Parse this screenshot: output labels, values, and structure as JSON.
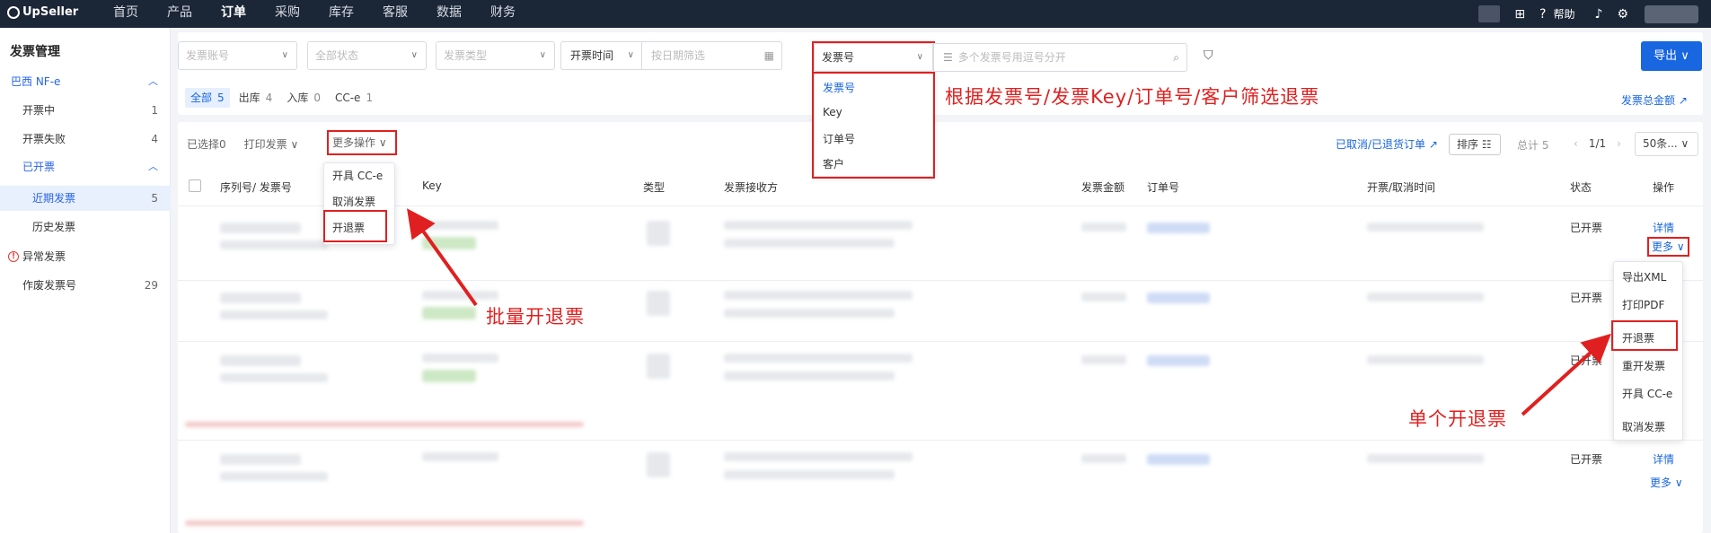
{
  "topbar": {
    "logo": "UpSeller",
    "nav": [
      "首页",
      "产品",
      "订单",
      "采购",
      "库存",
      "客服",
      "数据",
      "财务"
    ],
    "active_nav": "订单",
    "help": "帮助"
  },
  "sidebar": {
    "title": "发票管理",
    "group": "巴西 NF-e",
    "items": [
      {
        "label": "开票中",
        "count": "1"
      },
      {
        "label": "开票失败",
        "count": "4"
      },
      {
        "label": "已开票",
        "count": ""
      },
      {
        "label": "近期发票",
        "count": "5"
      },
      {
        "label": "历史发票",
        "count": ""
      },
      {
        "label": "异常发票",
        "count": ""
      },
      {
        "label": "作废发票号",
        "count": "29"
      }
    ]
  },
  "filters": {
    "account_placeholder": "发票账号",
    "status_placeholder": "全部状态",
    "type_placeholder": "发票类型",
    "date_type": "开票时间",
    "date_placeholder": "按日期筛选",
    "search_type": "发票号",
    "search_placeholder": "多个发票号用逗号分开",
    "export_label": "导出"
  },
  "search_type_options": [
    "发票号",
    "Key",
    "订单号",
    "客户"
  ],
  "tabs": [
    {
      "label": "全部",
      "count": "5"
    },
    {
      "label": "出库",
      "count": "4"
    },
    {
      "label": "入库",
      "count": "0"
    },
    {
      "label": "CC-e",
      "count": "1"
    }
  ],
  "total_link": "发票总金额",
  "toolbar": {
    "selected": "已选择0",
    "print": "打印发票",
    "more_ops": "更多操作",
    "cancelled_link": "已取消/已退货订单",
    "sort": "排序",
    "total": "总计 5",
    "page": "1/1",
    "page_size": "50条..."
  },
  "more_ops_menu": [
    "开具 CC-e",
    "取消发票",
    "开退票"
  ],
  "table": {
    "headers": [
      "序列号/ 发票号",
      "Key",
      "类型",
      "发票接收方",
      "发票金额",
      "订单号",
      "开票/取消时间",
      "状态",
      "操作"
    ],
    "row_status": "已开票",
    "detail": "详情",
    "more": "更多"
  },
  "row_more_menu": [
    "导出XML",
    "打印PDF",
    "开退票",
    "重开发票",
    "开具 CC-e",
    "取消发票"
  ],
  "annotations": {
    "filter_note": "根据发票号/发票Key/订单号/客户筛选退票",
    "batch_note": "批量开退票",
    "single_note": "单个开退票"
  }
}
